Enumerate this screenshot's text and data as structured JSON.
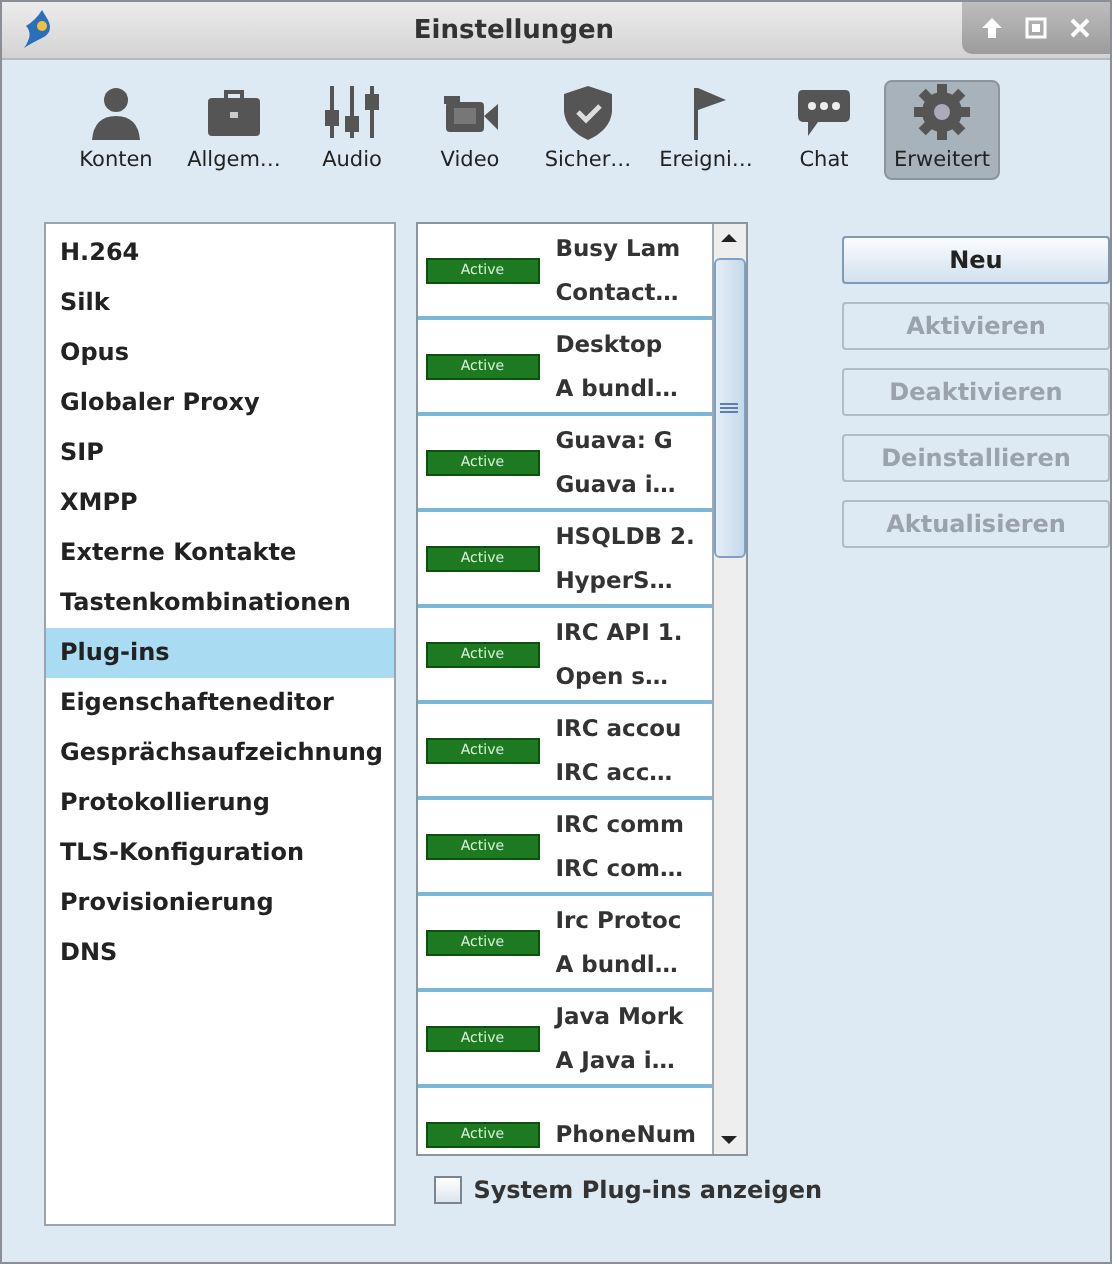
{
  "window": {
    "title": "Einstellungen"
  },
  "toolbar": [
    {
      "label": "Konten",
      "selected": false
    },
    {
      "label": "Allgem…",
      "selected": false
    },
    {
      "label": "Audio",
      "selected": false
    },
    {
      "label": "Video",
      "selected": false
    },
    {
      "label": "Sicher…",
      "selected": false
    },
    {
      "label": "Ereigni…",
      "selected": false
    },
    {
      "label": "Chat",
      "selected": false
    },
    {
      "label": "Erweitert",
      "selected": true
    }
  ],
  "sidebar": {
    "items": [
      {
        "label": "H.264",
        "selected": false
      },
      {
        "label": "Silk",
        "selected": false
      },
      {
        "label": "Opus",
        "selected": false
      },
      {
        "label": "Globaler Proxy",
        "selected": false
      },
      {
        "label": "SIP",
        "selected": false
      },
      {
        "label": "XMPP",
        "selected": false
      },
      {
        "label": "Externe Kontakte",
        "selected": false
      },
      {
        "label": "Tastenkombinationen",
        "selected": false
      },
      {
        "label": "Plug-ins",
        "selected": true
      },
      {
        "label": "Eigenschafteneditor",
        "selected": false
      },
      {
        "label": "Gesprächsaufzeichnung",
        "selected": false
      },
      {
        "label": "Protokollierung",
        "selected": false
      },
      {
        "label": "TLS-Konfiguration",
        "selected": false
      },
      {
        "label": "Provisionierung",
        "selected": false
      },
      {
        "label": "DNS",
        "selected": false
      }
    ]
  },
  "plugins": [
    {
      "status": "Active",
      "name": "Busy Lam",
      "description": "Contact…"
    },
    {
      "status": "Active",
      "name": "Desktop",
      "description": "A bundl…"
    },
    {
      "status": "Active",
      "name": "Guava: G",
      "description": "Guava i…"
    },
    {
      "status": "Active",
      "name": "HSQLDB 2.",
      "description": "HyperS…"
    },
    {
      "status": "Active",
      "name": "IRC API 1.",
      "description": "Open s…"
    },
    {
      "status": "Active",
      "name": "IRC accou",
      "description": "IRC acc…"
    },
    {
      "status": "Active",
      "name": "IRC comm",
      "description": "IRC com…"
    },
    {
      "status": "Active",
      "name": "Irc Protoc",
      "description": "A bundl…"
    },
    {
      "status": "Active",
      "name": "Java Mork",
      "description": "A Java i…"
    },
    {
      "status": "Active",
      "name": "PhoneNum"
    }
  ],
  "buttons": [
    {
      "label": "Neu",
      "disabled": false
    },
    {
      "label": "Aktivieren",
      "disabled": true
    },
    {
      "label": "Deaktivieren",
      "disabled": true
    },
    {
      "label": "Deinstallieren",
      "disabled": true
    },
    {
      "label": "Aktualisieren",
      "disabled": true
    }
  ],
  "show_system_plugins": {
    "label": "System Plug-ins anzeigen",
    "checked": false
  }
}
